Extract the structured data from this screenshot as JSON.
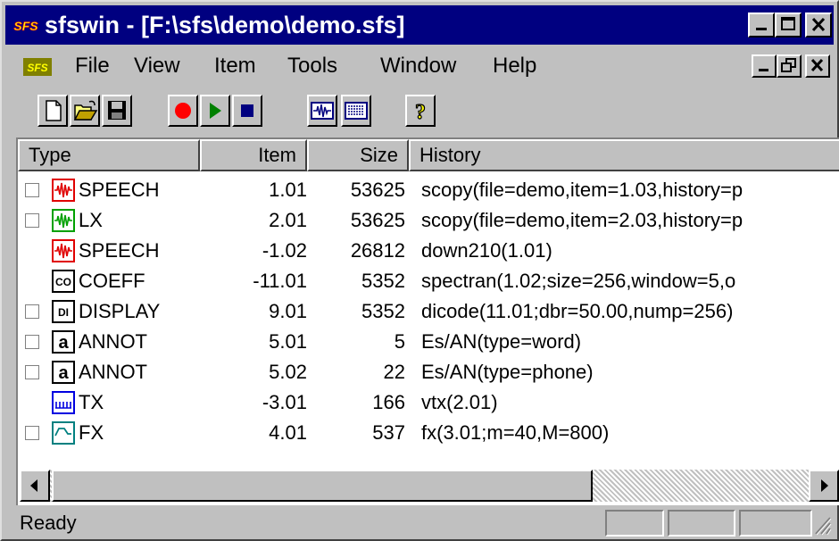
{
  "window": {
    "title": "sfswin - [F:\\sfs\\demo\\demo.sfs]",
    "app_icon_text": "SFS"
  },
  "menu": [
    "File",
    "View",
    "Item",
    "Tools",
    "Window",
    "Help"
  ],
  "columns": {
    "type": "Type",
    "item": "Item",
    "size": "Size",
    "history": "History"
  },
  "rows": [
    {
      "checkbox": true,
      "icon": "waveform-icon",
      "icon_color": "#e00000",
      "type": "SPEECH",
      "item": "1.01",
      "size": "53625",
      "history": "scopy(file=demo,item=1.03,history=p"
    },
    {
      "checkbox": true,
      "icon": "waveform-icon",
      "icon_color": "#00a000",
      "type": "LX",
      "item": "2.01",
      "size": "53625",
      "history": "scopy(file=demo,item=2.03,history=p"
    },
    {
      "checkbox": false,
      "icon": "waveform-icon",
      "icon_color": "#e00000",
      "type": "SPEECH",
      "item": "-1.02",
      "size": "26812",
      "history": "down210(1.01)"
    },
    {
      "checkbox": false,
      "icon": "coeff-icon",
      "icon_color": "#000000",
      "icon_text": "CO",
      "type": "COEFF",
      "item": "-11.01",
      "size": "5352",
      "history": "spectran(1.02;size=256,window=5,o"
    },
    {
      "checkbox": true,
      "icon": "display-icon",
      "icon_color": "#000000",
      "icon_text": "DI",
      "type": "DISPLAY",
      "item": "9.01",
      "size": "5352",
      "history": "dicode(11.01;dbr=50.00,nump=256)"
    },
    {
      "checkbox": true,
      "icon": "annot-icon",
      "icon_color": "#000000",
      "type": "ANNOT",
      "item": "5.01",
      "size": "5",
      "history": "Es/AN(type=word)"
    },
    {
      "checkbox": true,
      "icon": "annot-icon",
      "icon_color": "#000000",
      "type": "ANNOT",
      "item": "5.02",
      "size": "22",
      "history": "Es/AN(type=phone)"
    },
    {
      "checkbox": false,
      "icon": "tx-icon",
      "icon_color": "#0000e0",
      "type": "TX",
      "item": "-3.01",
      "size": "166",
      "history": "vtx(2.01)"
    },
    {
      "checkbox": true,
      "icon": "fx-icon",
      "icon_color": "#008080",
      "type": "FX",
      "item": "4.01",
      "size": "537",
      "history": "fx(3.01;m=40,M=800)"
    }
  ],
  "status": "Ready",
  "colors": {
    "titlebar": "#000080",
    "face": "#c0c0c0",
    "record": "#ff0000",
    "play": "#008000",
    "stop": "#000080"
  }
}
